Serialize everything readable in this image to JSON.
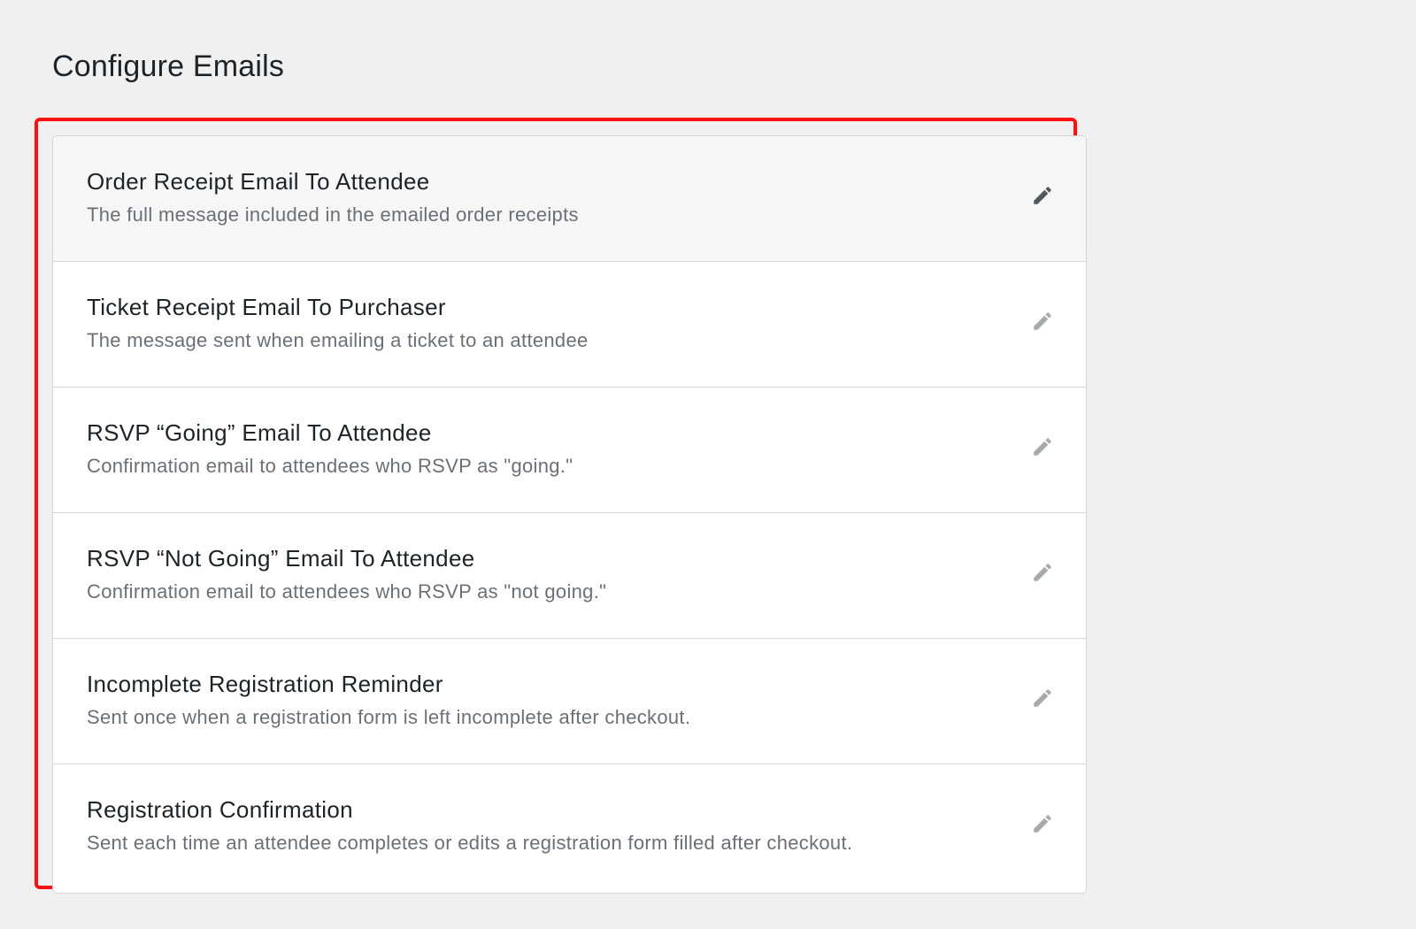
{
  "page": {
    "title": "Configure Emails"
  },
  "emails": [
    {
      "title": "Order Receipt Email To Attendee",
      "description": "The full message included in the emailed order receipts",
      "icon": "pencil-icon",
      "hovered": true
    },
    {
      "title": "Ticket Receipt Email To Purchaser",
      "description": "The message sent when emailing a ticket to an attendee",
      "icon": "pencil-icon",
      "hovered": false
    },
    {
      "title": "RSVP “Going” Email To Attendee",
      "description": "Confirmation email to attendees who RSVP as \"going.\"",
      "icon": "pencil-icon",
      "hovered": false
    },
    {
      "title": "RSVP “Not Going” Email To Attendee",
      "description": "Confirmation email to attendees who RSVP as \"not going.\"",
      "icon": "pencil-icon",
      "hovered": false
    },
    {
      "title": "Incomplete Registration Reminder",
      "description": "Sent once when a registration form is left incomplete after checkout.",
      "icon": "pencil-icon",
      "hovered": false
    },
    {
      "title": "Registration Confirmation",
      "description": "Sent each time an attendee completes or edits a registration form filled after checkout.",
      "icon": "pencil-icon",
      "hovered": false
    }
  ],
  "colors": {
    "highlight_frame": "#ff1010",
    "icon_active": "#50575e",
    "icon_inactive": "#a7aaad"
  }
}
